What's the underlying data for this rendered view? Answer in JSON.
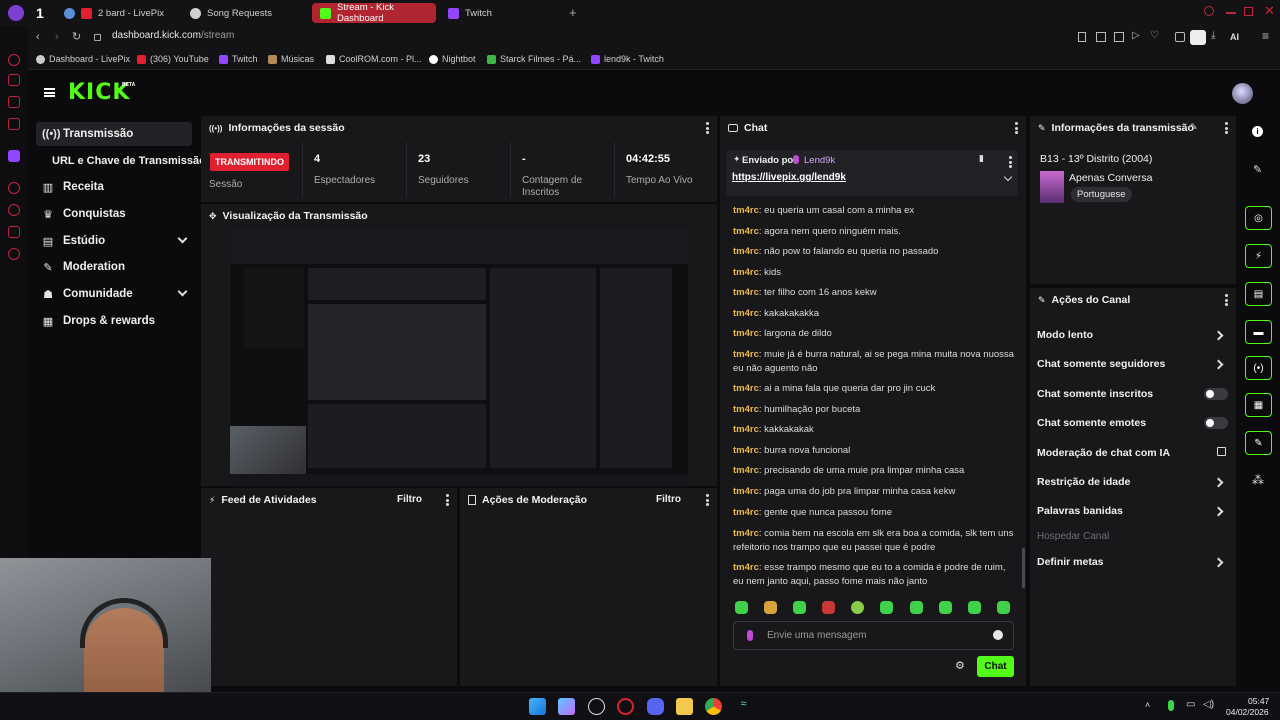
{
  "browser": {
    "tabs": [
      {
        "label": "1",
        "badge": true
      },
      {
        "label": "2 bard - LivePix"
      },
      {
        "label": "Song Requests"
      },
      {
        "label": "Stream - Kick Dashboard",
        "active": true
      },
      {
        "label": "Twitch"
      }
    ],
    "url_host": "dashboard.kick.com",
    "url_path": "/stream",
    "ai_label": "AI",
    "bookmarks": [
      "Dashboard - LivePix",
      "(306) YouTube",
      "Twitch",
      "Músicas",
      "CoolROM.com - Pl...",
      "Nightbot",
      "Starck Filmes - Pá...",
      "lend9k - Twitch"
    ]
  },
  "kick": {
    "logo": "KICK",
    "logo_badge": "BETA"
  },
  "nav": [
    {
      "label": "Transmissão",
      "icon": "broadcast-icon"
    },
    {
      "label": "URL e Chave de Transmissão"
    },
    {
      "label": "Receita",
      "icon": "chart-icon"
    },
    {
      "label": "Conquistas",
      "icon": "trophy-icon"
    },
    {
      "label": "Estúdio",
      "icon": "studio-icon"
    },
    {
      "label": "Moderation",
      "icon": "wrench-icon"
    },
    {
      "label": "Comunidade",
      "icon": "people-icon"
    },
    {
      "label": "Drops & rewards",
      "icon": "drops-icon"
    }
  ],
  "session": {
    "title": "Informações da sessão",
    "status": "TRANSMITINDO",
    "status_label": "Sessão",
    "stats": [
      {
        "value": "4",
        "label": "Espectadores"
      },
      {
        "value": "23",
        "label": "Seguidores"
      },
      {
        "value": "-",
        "label": "Contagem de Inscritos"
      },
      {
        "value": "04:42:55",
        "label": "Tempo Ao Vivo"
      }
    ]
  },
  "preview": {
    "title": "Visualização da Transmissão"
  },
  "activity": {
    "title": "Feed de Atividades",
    "filter": "Filtro"
  },
  "modactions": {
    "title": "Ações de Moderação",
    "filter": "Filtro"
  },
  "chat": {
    "title": "Chat",
    "pinned_by_label": "Enviado por",
    "pinned_user": "Lend9k",
    "pinned_link": "https://livepix.gg/lend9k",
    "messages": [
      {
        "user": "tm4rc",
        "text": "eu queria um casal com a minha ex"
      },
      {
        "user": "tm4rc",
        "text": "agora nem quero ninguém mais."
      },
      {
        "user": "tm4rc",
        "text": "não pow to falando eu queria no passado"
      },
      {
        "user": "tm4rc",
        "text": "kids"
      },
      {
        "user": "tm4rc",
        "text": "ter filho com 16 anos kekw"
      },
      {
        "user": "tm4rc",
        "text": "kakakakakka"
      },
      {
        "user": "tm4rc",
        "text": "largona de dildo"
      },
      {
        "user": "tm4rc",
        "text": "muie já é burra natural, ai se pega mina muita nova nuossa eu não aguento não"
      },
      {
        "user": "tm4rc",
        "text": "ai a mina fala que queria dar pro jin cuck"
      },
      {
        "user": "tm4rc",
        "text": "humilhação por buceta"
      },
      {
        "user": "tm4rc",
        "text": "kakkakakak"
      },
      {
        "user": "tm4rc",
        "text": "burra nova funcional"
      },
      {
        "user": "tm4rc",
        "text": "precisando de uma muie pra limpar minha casa"
      },
      {
        "user": "tm4rc",
        "text": "paga uma do job pra limpar minha casa kekw"
      },
      {
        "user": "tm4rc",
        "text": "gente que nunca passou fome"
      },
      {
        "user": "tm4rc",
        "text": "comia bem na escola em slk era boa a comida, slk tem uns refeitorio nos trampo que eu passei que é podre"
      },
      {
        "user": "tm4rc",
        "text": "esse trampo mesmo que eu to a comida é podre de ruim, eu nem janto aqui, passo fome mais não janto"
      }
    ],
    "input_placeholder": "Envie uma mensagem",
    "send_label": "Chat"
  },
  "broadcast_info": {
    "title": "Informações da transmissão",
    "stream_title": "B13 - 13º Distrito (2004)",
    "category": "Apenas Conversa",
    "language": "Portuguese"
  },
  "channel_actions": {
    "title": "Ações do Canal",
    "items": [
      {
        "label": "Modo lento",
        "control": "chevron"
      },
      {
        "label": "Chat somente seguidores",
        "control": "chevron"
      },
      {
        "label": "Chat somente inscritos",
        "control": "toggle",
        "on": false
      },
      {
        "label": "Chat somente emotes",
        "control": "toggle",
        "on": false
      },
      {
        "label": "Moderação de chat com IA",
        "control": "external"
      },
      {
        "label": "Restrição de idade",
        "control": "chevron"
      },
      {
        "label": "Palavras banidas",
        "control": "chevron"
      },
      {
        "label": "Hospedar Canal",
        "control": "none",
        "disabled": true
      },
      {
        "label": "Definir metas",
        "control": "chevron"
      }
    ]
  },
  "taskbar": {
    "time": "05:47",
    "date": "04/02/2026"
  },
  "colors": {
    "kick_green": "#53fc18",
    "live_red": "#e0202e",
    "username": "#e8b84a",
    "panel": "#18181b"
  }
}
